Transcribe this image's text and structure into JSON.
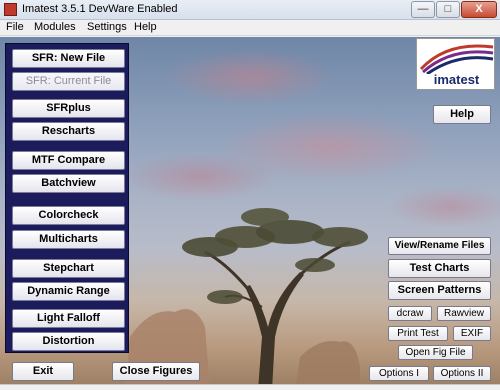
{
  "window": {
    "title": "Imatest 3.5.1  DevWare Enabled",
    "controls": {
      "minimize": "—",
      "maximize": "□",
      "close": "X"
    }
  },
  "menu": [
    "File",
    "Modules",
    "Settings",
    "Help"
  ],
  "left_panel": {
    "sfr_new": "SFR: New File",
    "sfr_current": "SFR: Current File",
    "sfrplus": "SFRplus",
    "rescharts": "Rescharts",
    "mtf_compare": "MTF Compare",
    "batchview": "Batchview",
    "colorcheck": "Colorcheck",
    "multicharts": "Multicharts",
    "stepchart": "Stepchart",
    "dynamic_range": "Dynamic Range",
    "light_falloff": "Light Falloff",
    "distortion": "Distortion"
  },
  "bottom": {
    "exit": "Exit",
    "close_figures": "Close Figures"
  },
  "right": {
    "logo_text": "imatest",
    "help": "Help",
    "view_rename": "View/Rename Files",
    "test_charts": "Test Charts",
    "screen_patterns": "Screen Patterns",
    "dcraw": "dcraw",
    "rawview": "Rawview",
    "print_test": "Print Test",
    "exif": "EXIF",
    "open_fig_file": "Open Fig File",
    "options_1": "Options I",
    "options_2": "Options II"
  },
  "colors": {
    "panel": "#1c1c5c",
    "logo_red": "#c0392b",
    "logo_purple": "#7a2a8a",
    "logo_blue": "#1b2a6b"
  }
}
